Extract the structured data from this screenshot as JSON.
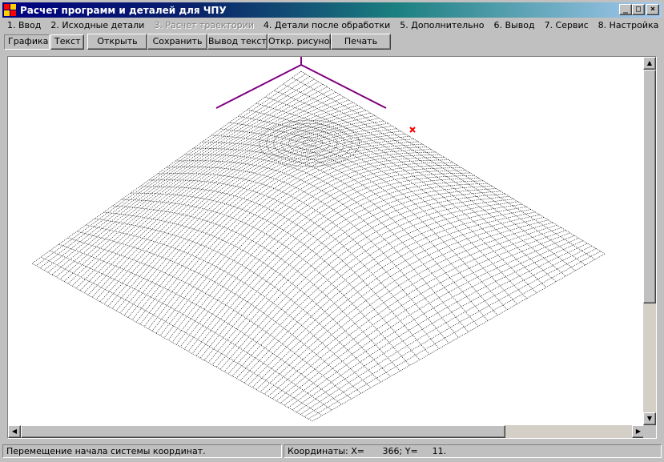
{
  "window": {
    "title": "Расчет программ и деталей для ЧПУ",
    "minimize_glyph": "_",
    "maximize_glyph": "□",
    "close_glyph": "×"
  },
  "menu": [
    {
      "label": "1. Ввод",
      "enabled": true
    },
    {
      "label": "2. Исходные детали",
      "enabled": true
    },
    {
      "label": "3. Расчет траектории",
      "enabled": false
    },
    {
      "label": "4. Детали после обработки",
      "enabled": true
    },
    {
      "label": "5. Дополнительно",
      "enabled": true
    },
    {
      "label": "6. Вывод",
      "enabled": true
    },
    {
      "label": "7. Сервис",
      "enabled": true
    },
    {
      "label": "8. Настройка",
      "enabled": true
    },
    {
      "label": "?",
      "enabled": true
    }
  ],
  "tabs": [
    {
      "label": "Графика",
      "active": true
    },
    {
      "label": "Текст",
      "active": false
    }
  ],
  "toolbar": {
    "open": "Открыть",
    "save": "Сохранить",
    "text_output": "Вывод текста",
    "open_picture": "Откр. рисунок",
    "print": "Печать"
  },
  "status": {
    "message": "Перемещение начала системы координат.",
    "coords_label": "Координаты: X=",
    "x_value": "366",
    "y_label": "Y=",
    "y_value": "11."
  },
  "colors": {
    "axis": "#800080",
    "marker": "#ff0000",
    "mesh": "#000000"
  },
  "icons": {
    "app": "app-icon",
    "scroll_up": "arrow-up-icon",
    "scroll_down": "arrow-down-icon",
    "scroll_left": "arrow-left-icon",
    "scroll_right": "arrow-right-icon"
  }
}
